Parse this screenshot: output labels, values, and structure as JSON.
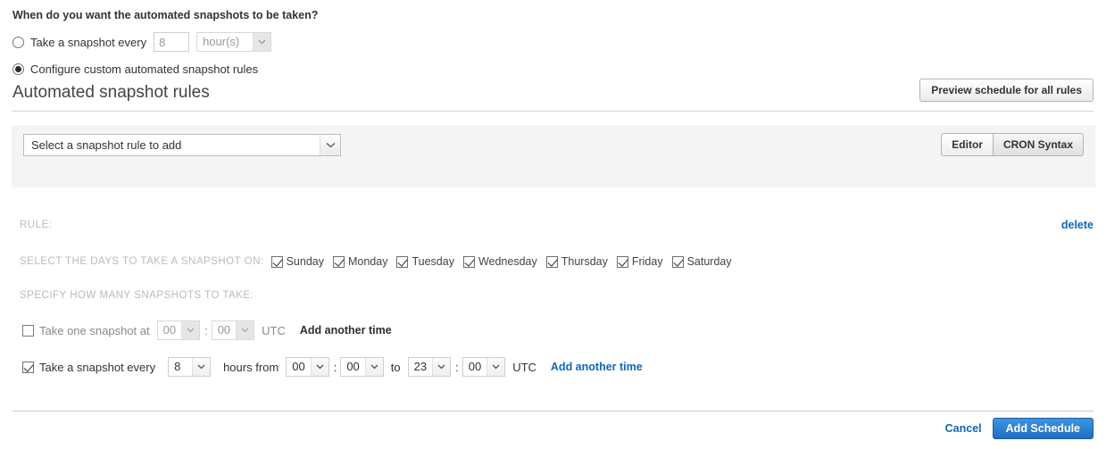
{
  "question": "When do you want the automated snapshots to be taken?",
  "interval_option": {
    "label": "Take a snapshot every",
    "value": "8",
    "unit": "hour(s)",
    "selected": false
  },
  "custom_option": {
    "label": "Configure custom automated snapshot rules",
    "selected": true
  },
  "section": {
    "title": "Automated snapshot rules",
    "preview_button": "Preview schedule for all rules"
  },
  "rule_picker": {
    "placeholder": "Select a snapshot rule to add",
    "editor_tab": "Editor",
    "cron_tab": "CRON Syntax"
  },
  "rule": {
    "label": "RULE:",
    "delete_label": "delete",
    "days_label": "SELECT THE DAYS TO TAKE A SNAPSHOT ON:",
    "days": [
      {
        "name": "Sunday",
        "checked": true
      },
      {
        "name": "Monday",
        "checked": true
      },
      {
        "name": "Tuesday",
        "checked": true
      },
      {
        "name": "Wednesday",
        "checked": true
      },
      {
        "name": "Thursday",
        "checked": true
      },
      {
        "name": "Friday",
        "checked": true
      },
      {
        "name": "Saturday",
        "checked": true
      }
    ],
    "specify_label": "SPECIFY HOW MANY SNAPSHOTS TO TAKE:",
    "once": {
      "label": "Take one snapshot at",
      "checked": false,
      "hour": "00",
      "minute": "00",
      "timezone": "UTC",
      "add_time_label": "Add another time"
    },
    "every": {
      "label": "Take a snapshot every",
      "checked": true,
      "interval": "8",
      "hours_from_label": "hours from",
      "from_hour": "00",
      "from_minute": "00",
      "to_label": "to",
      "to_hour": "23",
      "to_minute": "00",
      "timezone": "UTC",
      "add_time_label": "Add another time"
    }
  },
  "footer": {
    "cancel_label": "Cancel",
    "submit_label": "Add Schedule"
  },
  "colors": {
    "link_blue": "#1166bb",
    "primary_blue": "#2f7fd0",
    "caps_gray": "#b9bbbd",
    "band_gray": "#f4f4f4"
  }
}
